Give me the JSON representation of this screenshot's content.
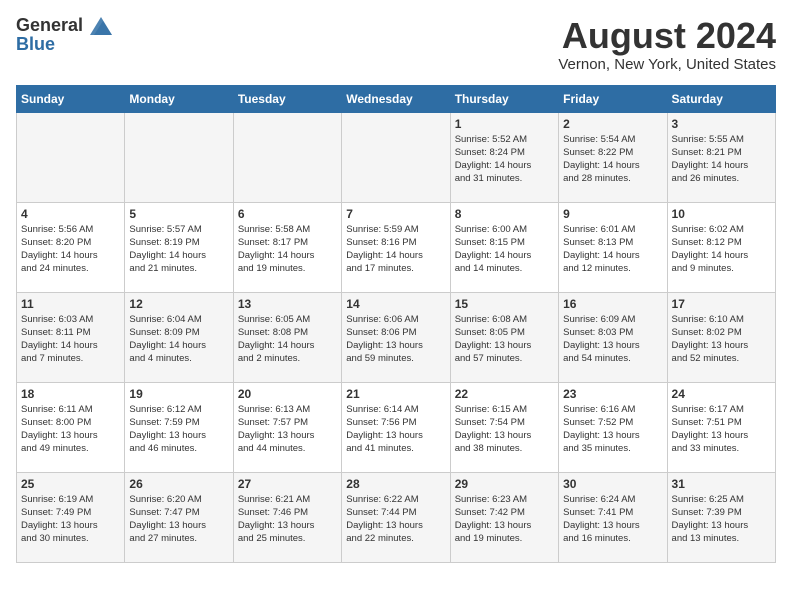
{
  "header": {
    "logo_general": "General",
    "logo_blue": "Blue",
    "month_title": "August 2024",
    "location": "Vernon, New York, United States"
  },
  "weekdays": [
    "Sunday",
    "Monday",
    "Tuesday",
    "Wednesday",
    "Thursday",
    "Friday",
    "Saturday"
  ],
  "weeks": [
    [
      {
        "day": "",
        "info": ""
      },
      {
        "day": "",
        "info": ""
      },
      {
        "day": "",
        "info": ""
      },
      {
        "day": "",
        "info": ""
      },
      {
        "day": "1",
        "info": "Sunrise: 5:52 AM\nSunset: 8:24 PM\nDaylight: 14 hours\nand 31 minutes."
      },
      {
        "day": "2",
        "info": "Sunrise: 5:54 AM\nSunset: 8:22 PM\nDaylight: 14 hours\nand 28 minutes."
      },
      {
        "day": "3",
        "info": "Sunrise: 5:55 AM\nSunset: 8:21 PM\nDaylight: 14 hours\nand 26 minutes."
      }
    ],
    [
      {
        "day": "4",
        "info": "Sunrise: 5:56 AM\nSunset: 8:20 PM\nDaylight: 14 hours\nand 24 minutes."
      },
      {
        "day": "5",
        "info": "Sunrise: 5:57 AM\nSunset: 8:19 PM\nDaylight: 14 hours\nand 21 minutes."
      },
      {
        "day": "6",
        "info": "Sunrise: 5:58 AM\nSunset: 8:17 PM\nDaylight: 14 hours\nand 19 minutes."
      },
      {
        "day": "7",
        "info": "Sunrise: 5:59 AM\nSunset: 8:16 PM\nDaylight: 14 hours\nand 17 minutes."
      },
      {
        "day": "8",
        "info": "Sunrise: 6:00 AM\nSunset: 8:15 PM\nDaylight: 14 hours\nand 14 minutes."
      },
      {
        "day": "9",
        "info": "Sunrise: 6:01 AM\nSunset: 8:13 PM\nDaylight: 14 hours\nand 12 minutes."
      },
      {
        "day": "10",
        "info": "Sunrise: 6:02 AM\nSunset: 8:12 PM\nDaylight: 14 hours\nand 9 minutes."
      }
    ],
    [
      {
        "day": "11",
        "info": "Sunrise: 6:03 AM\nSunset: 8:11 PM\nDaylight: 14 hours\nand 7 minutes."
      },
      {
        "day": "12",
        "info": "Sunrise: 6:04 AM\nSunset: 8:09 PM\nDaylight: 14 hours\nand 4 minutes."
      },
      {
        "day": "13",
        "info": "Sunrise: 6:05 AM\nSunset: 8:08 PM\nDaylight: 14 hours\nand 2 minutes."
      },
      {
        "day": "14",
        "info": "Sunrise: 6:06 AM\nSunset: 8:06 PM\nDaylight: 13 hours\nand 59 minutes."
      },
      {
        "day": "15",
        "info": "Sunrise: 6:08 AM\nSunset: 8:05 PM\nDaylight: 13 hours\nand 57 minutes."
      },
      {
        "day": "16",
        "info": "Sunrise: 6:09 AM\nSunset: 8:03 PM\nDaylight: 13 hours\nand 54 minutes."
      },
      {
        "day": "17",
        "info": "Sunrise: 6:10 AM\nSunset: 8:02 PM\nDaylight: 13 hours\nand 52 minutes."
      }
    ],
    [
      {
        "day": "18",
        "info": "Sunrise: 6:11 AM\nSunset: 8:00 PM\nDaylight: 13 hours\nand 49 minutes."
      },
      {
        "day": "19",
        "info": "Sunrise: 6:12 AM\nSunset: 7:59 PM\nDaylight: 13 hours\nand 46 minutes."
      },
      {
        "day": "20",
        "info": "Sunrise: 6:13 AM\nSunset: 7:57 PM\nDaylight: 13 hours\nand 44 minutes."
      },
      {
        "day": "21",
        "info": "Sunrise: 6:14 AM\nSunset: 7:56 PM\nDaylight: 13 hours\nand 41 minutes."
      },
      {
        "day": "22",
        "info": "Sunrise: 6:15 AM\nSunset: 7:54 PM\nDaylight: 13 hours\nand 38 minutes."
      },
      {
        "day": "23",
        "info": "Sunrise: 6:16 AM\nSunset: 7:52 PM\nDaylight: 13 hours\nand 35 minutes."
      },
      {
        "day": "24",
        "info": "Sunrise: 6:17 AM\nSunset: 7:51 PM\nDaylight: 13 hours\nand 33 minutes."
      }
    ],
    [
      {
        "day": "25",
        "info": "Sunrise: 6:19 AM\nSunset: 7:49 PM\nDaylight: 13 hours\nand 30 minutes."
      },
      {
        "day": "26",
        "info": "Sunrise: 6:20 AM\nSunset: 7:47 PM\nDaylight: 13 hours\nand 27 minutes."
      },
      {
        "day": "27",
        "info": "Sunrise: 6:21 AM\nSunset: 7:46 PM\nDaylight: 13 hours\nand 25 minutes."
      },
      {
        "day": "28",
        "info": "Sunrise: 6:22 AM\nSunset: 7:44 PM\nDaylight: 13 hours\nand 22 minutes."
      },
      {
        "day": "29",
        "info": "Sunrise: 6:23 AM\nSunset: 7:42 PM\nDaylight: 13 hours\nand 19 minutes."
      },
      {
        "day": "30",
        "info": "Sunrise: 6:24 AM\nSunset: 7:41 PM\nDaylight: 13 hours\nand 16 minutes."
      },
      {
        "day": "31",
        "info": "Sunrise: 6:25 AM\nSunset: 7:39 PM\nDaylight: 13 hours\nand 13 minutes."
      }
    ]
  ]
}
